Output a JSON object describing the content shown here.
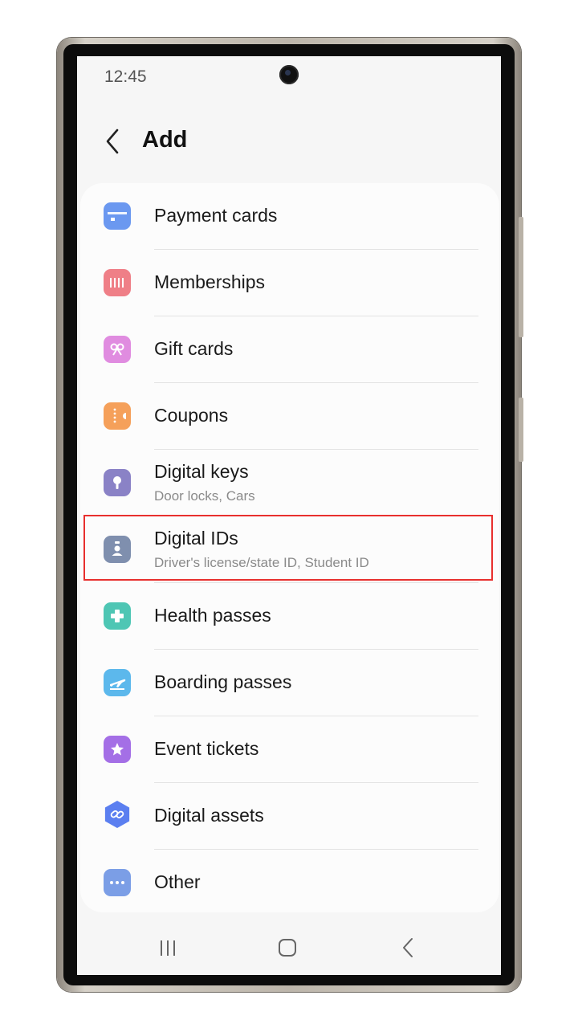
{
  "status_bar": {
    "time": "12:45"
  },
  "header": {
    "title": "Add"
  },
  "items": [
    {
      "label": "Payment cards",
      "sub": "",
      "icon": "card-icon",
      "color": "#6b98f0"
    },
    {
      "label": "Memberships",
      "sub": "",
      "icon": "membership-barcode-icon",
      "color": "#ef7f87"
    },
    {
      "label": "Gift cards",
      "sub": "",
      "icon": "gift-bow-icon",
      "color": "#e08ce0"
    },
    {
      "label": "Coupons",
      "sub": "",
      "icon": "coupon-ticket-icon",
      "color": "#f5a05a"
    },
    {
      "label": "Digital keys",
      "sub": "Door locks, Cars",
      "icon": "key-lock-icon",
      "color": "#8a82c6"
    },
    {
      "label": "Digital IDs",
      "sub": "Driver's license/state ID, Student ID",
      "icon": "id-badge-icon",
      "color": "#7f8fae"
    },
    {
      "label": "Health passes",
      "sub": "",
      "icon": "health-cross-icon",
      "color": "#4ec6b4"
    },
    {
      "label": "Boarding passes",
      "sub": "",
      "icon": "airplane-icon",
      "color": "#5cb8ec"
    },
    {
      "label": "Event tickets",
      "sub": "",
      "icon": "star-ticket-icon",
      "color": "#a46fe6"
    },
    {
      "label": "Digital assets",
      "sub": "",
      "icon": "link-hexagon-icon",
      "color": "#5b7ff0"
    },
    {
      "label": "Other",
      "sub": "",
      "icon": "more-dots-icon",
      "color": "#7b9ee6"
    }
  ],
  "highlight_color": "#e8302e"
}
